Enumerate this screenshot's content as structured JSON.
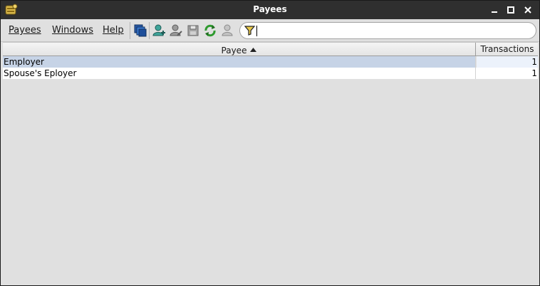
{
  "window": {
    "title": "Payees"
  },
  "menu": {
    "payees": "Payees",
    "windows": "Windows",
    "help": "Help"
  },
  "toolbar": {
    "icons": [
      "windows-icon",
      "add-payee-icon",
      "edit-payee-icon",
      "save-icon",
      "refresh-icon",
      "delete-payee-icon"
    ]
  },
  "filter": {
    "value": ""
  },
  "table": {
    "columns": [
      "Payee",
      "Transactions"
    ],
    "sort": "Payee ascending",
    "rows": [
      {
        "payee": "Employer",
        "transactions": "1"
      },
      {
        "payee": "Spouse's Eployer",
        "transactions": "1"
      }
    ]
  },
  "colors": {
    "titlebar": "#2f2f2f",
    "background": "#e0e0e0",
    "selection": "#c6d3e6"
  }
}
